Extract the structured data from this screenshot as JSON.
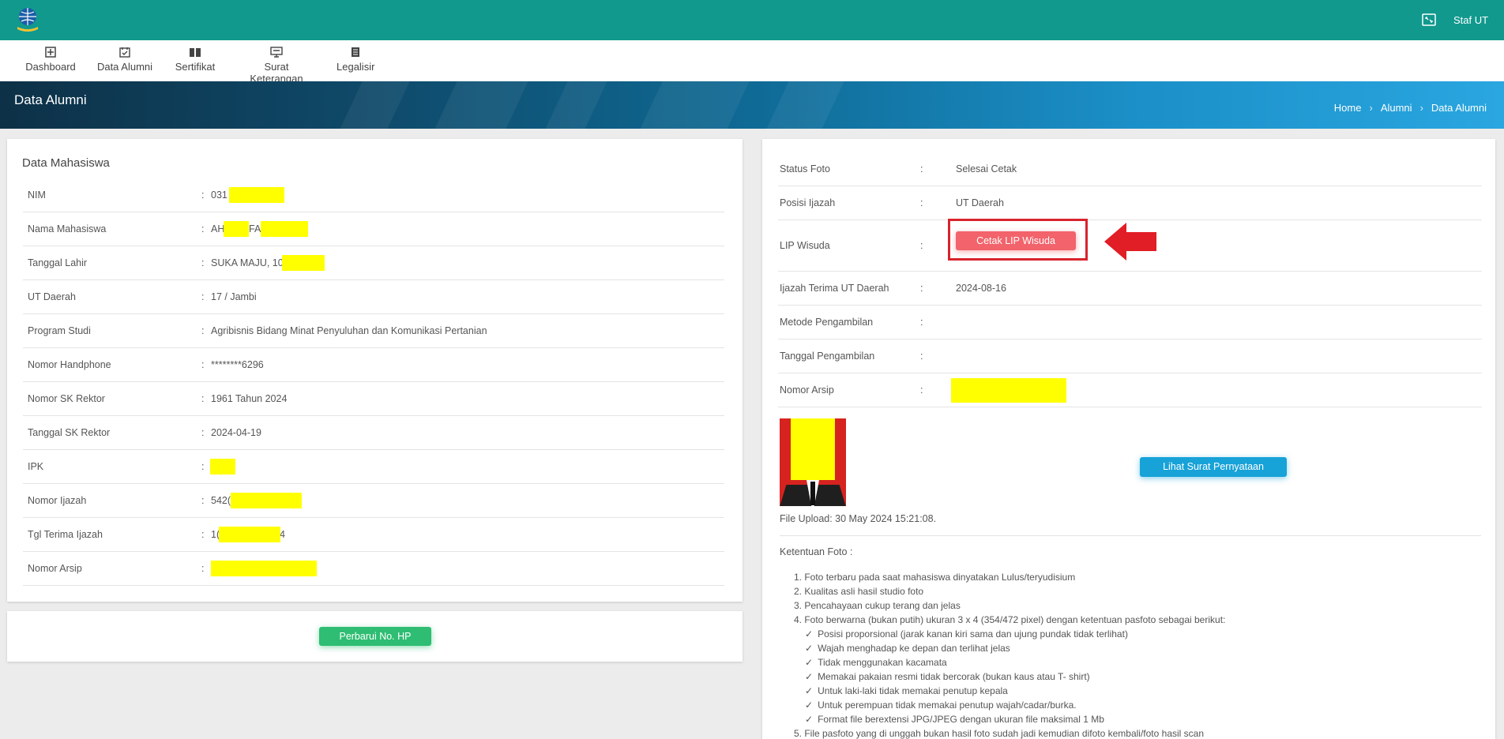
{
  "topbar": {
    "user_label": "Staf UT",
    "color": "#11998e"
  },
  "nav": [
    {
      "label": "Dashboard",
      "icon": "dashboard-icon"
    },
    {
      "label": "Data Alumni",
      "icon": "calendar-check-icon"
    },
    {
      "label": "Sertifikat",
      "icon": "book-icon"
    },
    {
      "label": "Surat Keterangan",
      "icon": "monitor-icon"
    },
    {
      "label": "Legalisir",
      "icon": "document-icon"
    }
  ],
  "hero": {
    "title": "Data Alumni",
    "breadcrumb": [
      "Home",
      "Alumni",
      "Data Alumni"
    ]
  },
  "left_card": {
    "title": "Data Mahasiswa",
    "rows": [
      {
        "label": "NIM",
        "value": "031"
      },
      {
        "label": "Nama Mahasiswa",
        "value": "AH",
        "value2": "FA"
      },
      {
        "label": "Tanggal Lahir",
        "value": "SUKA MAJU, 10,"
      },
      {
        "label": "UT Daerah",
        "value": "17 / Jambi"
      },
      {
        "label": "Program Studi",
        "value": "Agribisnis Bidang Minat Penyuluhan dan Komunikasi Pertanian"
      },
      {
        "label": "Nomor Handphone",
        "value": "********6296"
      },
      {
        "label": "Nomor SK Rektor",
        "value": "1961 Tahun 2024"
      },
      {
        "label": "Tanggal SK Rektor",
        "value": "2024-04-19"
      },
      {
        "label": "IPK",
        "value": ""
      },
      {
        "label": "Nomor Ijazah",
        "value": "542("
      },
      {
        "label": "Tgl Terima Ijazah",
        "value": "1(",
        "value2": "4"
      },
      {
        "label": "Nomor Arsip",
        "value": ""
      }
    ]
  },
  "update_button": "Perbarui No. HP",
  "right_card": {
    "rows": [
      {
        "label": "Status Foto",
        "value": "Selesai Cetak"
      },
      {
        "label": "Posisi Ijazah",
        "value": "UT Daerah"
      },
      {
        "label": "LIP Wisuda",
        "value": ""
      },
      {
        "label": "Ijazah Terima UT Daerah",
        "value": "2024-08-16"
      },
      {
        "label": "Metode Pengambilan",
        "value": ""
      },
      {
        "label": "Tanggal Pengambilan",
        "value": ""
      },
      {
        "label": "Nomor Arsip",
        "value": ""
      }
    ],
    "cetak_button": "Cetak LIP Wisuda",
    "lihat_button": "Lihat Surat Pernyataan",
    "file_upload": "File Upload: 30 May 2024 15:21:08.",
    "ketentuan_title": "Ketentuan Foto :",
    "rules": [
      "1. Foto terbaru pada saat mahasiswa dinyatakan Lulus/teryudisium",
      "2. Kualitas asli hasil studio foto",
      "3. Pencahayaan cukup terang dan jelas",
      "4. Foto berwarna (bukan putih) ukuran 3 x 4 (354/472 pixel) dengan ketentuan pasfoto sebagai berikut:"
    ],
    "sub_rules": [
      "Posisi proporsional (jarak kanan kiri sama dan ujung pundak tidak terlihat)",
      "Wajah menghadap ke depan dan terlihat jelas",
      "Tidak menggunakan kacamata",
      "Memakai pakaian resmi tidak bercorak (bukan kaus atau T- shirt)",
      "Untuk laki-laki tidak memakai penutup kepala",
      "Untuk perempuan tidak memakai penutup wajah/cadar/burka.",
      "Format file berextensi JPG/JPEG dengan ukuran file maksimal 1 Mb"
    ],
    "rule5": "5. File pasfoto yang di unggah bukan hasil foto sudah jadi kemudian difoto kembali/foto hasil scan"
  }
}
